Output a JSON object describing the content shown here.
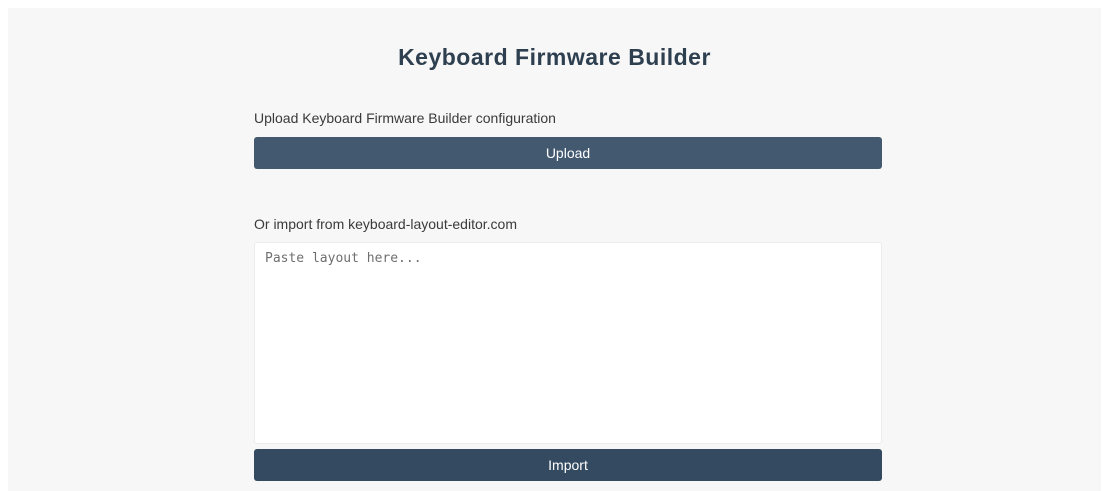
{
  "header": {
    "title": "Keyboard Firmware Builder"
  },
  "upload_section": {
    "label": "Upload Keyboard Firmware Builder configuration",
    "button_label": "Upload"
  },
  "import_section": {
    "label": "Or import from keyboard-layout-editor.com",
    "textarea_value": "",
    "textarea_placeholder": "Paste layout here...",
    "button_label": "Import"
  },
  "colors": {
    "title_text": "#2e3f50",
    "button_upload": "#435970",
    "button_import": "#344a60",
    "background": "#f7f7f7"
  }
}
